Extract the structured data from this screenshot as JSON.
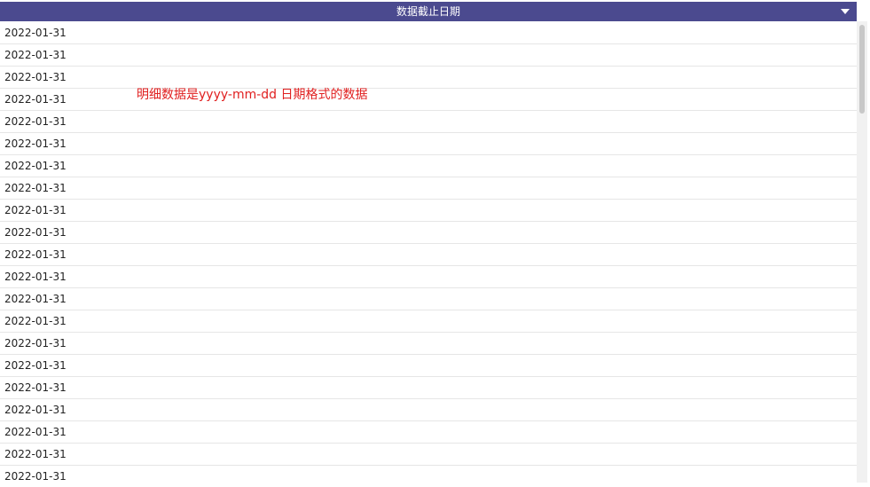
{
  "header": {
    "title": "数据截止日期",
    "background_color": "#4b4a8f"
  },
  "annotation": {
    "text": "明细数据是yyyy-mm-dd 日期格式的数据",
    "color": "#e02020"
  },
  "rows": [
    "2022-01-31",
    "2022-01-31",
    "2022-01-31",
    "2022-01-31",
    "2022-01-31",
    "2022-01-31",
    "2022-01-31",
    "2022-01-31",
    "2022-01-31",
    "2022-01-31",
    "2022-01-31",
    "2022-01-31",
    "2022-01-31",
    "2022-01-31",
    "2022-01-31",
    "2022-01-31",
    "2022-01-31",
    "2022-01-31",
    "2022-01-31",
    "2022-01-31",
    "2022-01-31"
  ]
}
